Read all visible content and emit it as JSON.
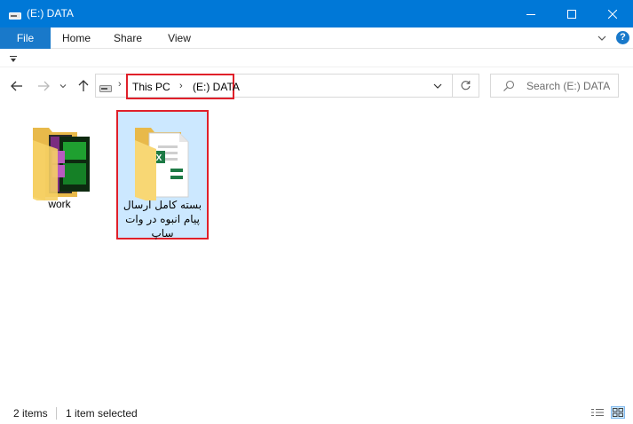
{
  "window": {
    "title": "(E:) DATA",
    "icon": "drive-icon",
    "controls": [
      "minimize-icon",
      "maximize-icon",
      "close-icon"
    ]
  },
  "ribbon": {
    "tabs": [
      {
        "label": "File"
      },
      {
        "label": "Home"
      },
      {
        "label": "Share"
      },
      {
        "label": "View"
      }
    ],
    "help": "?"
  },
  "nav": {
    "breadcrumb": [
      {
        "label": "This PC"
      },
      {
        "label": "(E:) DATA"
      }
    ],
    "separator": "›",
    "search_placeholder": "Search (E:) DATA"
  },
  "items": [
    {
      "name": "work",
      "icon": "folder-icon",
      "selected": false
    },
    {
      "name": "بسته کامل ارسال پیام انبوه در وات ساپ",
      "icon": "folder-icon",
      "selected": true
    }
  ],
  "status": {
    "count": "2 items",
    "selection": "1 item selected"
  },
  "colors": {
    "titlebar": "#0078d7",
    "file_tab": "#1979ca",
    "selection_bg": "#cce8ff",
    "highlight_border": "#e0202a"
  }
}
